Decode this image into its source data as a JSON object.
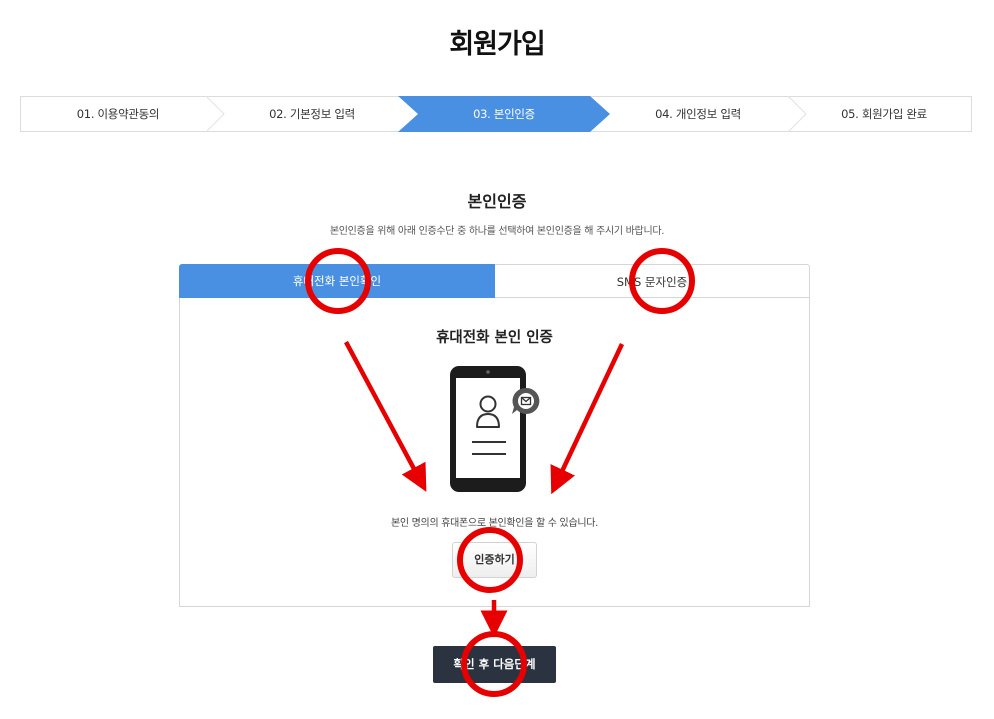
{
  "page": {
    "title": "회원가입"
  },
  "steps": [
    {
      "label": "01. 이용약관동의",
      "active": false
    },
    {
      "label": "02. 기본정보 입력",
      "active": false
    },
    {
      "label": "03. 본인인증",
      "active": true
    },
    {
      "label": "04. 개인정보 입력",
      "active": false
    },
    {
      "label": "05. 회원가입 완료",
      "active": false
    }
  ],
  "section": {
    "title": "본인인증",
    "description": "본인인증을 위해 아래 인증수단 중 하나를 선택하여 본인인증을 해 주시기 바랍니다."
  },
  "tabs": {
    "phone": "휴대전화 본인확인",
    "sms": "SMS 문자인증"
  },
  "panel": {
    "title": "휴대전화 본인 인증",
    "description": "본인 명의의 휴대폰으로 본인확인을 할 수 있습니다.",
    "verify_label": "인증하기"
  },
  "next": {
    "label": "확인 후 다음단계"
  },
  "icons": {
    "phone": "smartphone-user-icon",
    "message": "mail-bubble-icon"
  },
  "colors": {
    "active_step": "#4a90e2",
    "next_button": "#2b3340",
    "annotation": "#e60000"
  }
}
